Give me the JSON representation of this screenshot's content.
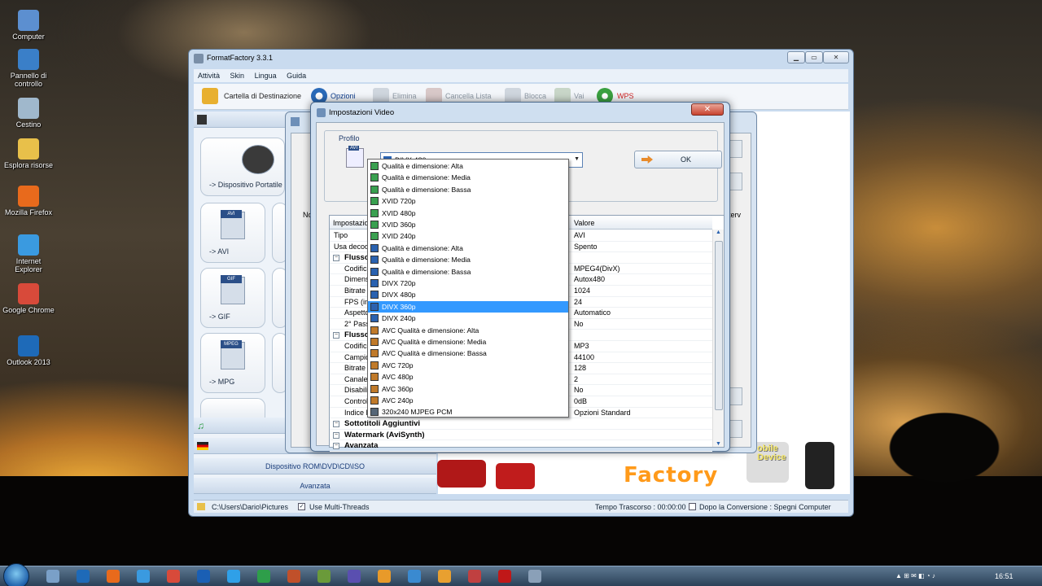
{
  "desktop": {
    "icons": [
      {
        "label": "Computer",
        "color": "#5c8fd0"
      },
      {
        "label": "Pannello di controllo",
        "color": "#3a7fc8"
      },
      {
        "label": "Cestino",
        "color": "#a0b8cc"
      },
      {
        "label": "Esplora risorse",
        "color": "#e8c04a"
      },
      {
        "label": "Mozilla Firefox",
        "color": "#e86a1c"
      },
      {
        "label": "Internet Explorer",
        "color": "#3a9ae0"
      },
      {
        "label": "Google Chrome",
        "color": "#d84a3a"
      },
      {
        "label": "Outlook 2013",
        "color": "#1e6ab8"
      }
    ]
  },
  "app": {
    "title": "FormatFactory 3.3.1",
    "window_controls": {
      "minimize": "▁",
      "maximize": "▭",
      "close": "✕"
    },
    "menu": [
      "Attività",
      "Skin",
      "Lingua",
      "Guida"
    ],
    "toolbar": {
      "destination": "Cartella di Destinazione",
      "options": "Opzioni",
      "delete": "Elimina",
      "clear": "Cancella Lista",
      "stop": "Blocca",
      "go": "Vai",
      "wps": "WPS"
    },
    "sidebar": {
      "portable": "-> Dispositivo Portatile",
      "formats": [
        {
          "tag": "AVI",
          "label": "-> AVI"
        },
        {
          "tag": "GIF",
          "label": "-> GIF"
        },
        {
          "tag": "MPEG",
          "label": "-> MPG"
        }
      ],
      "categories": {
        "rom": "Dispositivo ROM\\DVD\\CD\\ISO",
        "advanced": "Avanzata"
      }
    },
    "status": {
      "path": "C:\\Users\\Dario\\Pictures",
      "multithreads": "Use Multi-Threads",
      "elapsed": "Tempo Trascorso : 00:00:00",
      "after": "Dopo la Conversione : Spegni Computer"
    },
    "promo": {
      "brand": "Factory",
      "device": "obile Device"
    }
  },
  "background_dialog": {
    "col_left": "No",
    "col_right": "iterv"
  },
  "dialog": {
    "title": "Impostazioni Video",
    "close": "✕",
    "profile_group": "Profilo",
    "icon_tag": "AVI",
    "profile_value": "DIVX 480p",
    "ok": "OK",
    "grid": {
      "col_setting": "Impostazioni",
      "col_value": "Valore",
      "rows": [
        {
          "k": "Tipo",
          "v": "AVI",
          "kind": "plain"
        },
        {
          "k": "Usa decoder",
          "v": "Spento",
          "kind": "plain"
        },
        {
          "k": "Flusso Video",
          "v": "",
          "kind": "sec"
        },
        {
          "k": "Codifica",
          "v": "MPEG4(DivX)",
          "kind": "sub"
        },
        {
          "k": "Dimensioni",
          "v": "Autox480",
          "kind": "sub"
        },
        {
          "k": "Bitrate (K",
          "v": "1024",
          "kind": "sub"
        },
        {
          "k": "FPS (imm",
          "v": "24",
          "kind": "sub"
        },
        {
          "k": "Aspetto",
          "v": "Automatico",
          "kind": "sub"
        },
        {
          "k": "2° Passag",
          "v": "No",
          "kind": "sub"
        },
        {
          "k": "Flusso Audio",
          "v": "",
          "kind": "sec"
        },
        {
          "k": "Codifica A",
          "v": "MP3",
          "kind": "sub"
        },
        {
          "k": "Campiona",
          "v": "44100",
          "kind": "sub"
        },
        {
          "k": "Bitrate (K",
          "v": "128",
          "kind": "sub"
        },
        {
          "k": "Canale A",
          "v": "2",
          "kind": "sub"
        },
        {
          "k": "Disabilita",
          "v": "No",
          "kind": "sub"
        },
        {
          "k": "Controllo",
          "v": "0dB",
          "kind": "sub"
        },
        {
          "k": "Indice FL",
          "v": "Opzioni Standard",
          "kind": "sub"
        },
        {
          "k": "Sottotitoli Aggiuntivi",
          "v": "",
          "kind": "sec"
        },
        {
          "k": "Watermark (AviSynth)",
          "v": "",
          "kind": "sec"
        },
        {
          "k": "Avanzata",
          "v": "",
          "kind": "sec"
        }
      ]
    },
    "dropdown": [
      {
        "t": "Qualità e dimensione: Alta",
        "c": "#3aa050"
      },
      {
        "t": "Qualità e dimensione: Media",
        "c": "#3aa050"
      },
      {
        "t": "Qualità e dimensione: Bassa",
        "c": "#3aa050"
      },
      {
        "t": "XVID 720p",
        "c": "#3aa050"
      },
      {
        "t": "XVID 480p",
        "c": "#3aa050"
      },
      {
        "t": "XVID 360p",
        "c": "#3aa050"
      },
      {
        "t": "XVID 240p",
        "c": "#3aa050"
      },
      {
        "t": "Qualità e dimensione: Alta",
        "c": "#2a62b0"
      },
      {
        "t": "Qualità e dimensione: Media",
        "c": "#2a62b0"
      },
      {
        "t": "Qualità e dimensione: Bassa",
        "c": "#2a62b0"
      },
      {
        "t": "DIVX 720p",
        "c": "#2a62b0"
      },
      {
        "t": "DIVX 480p",
        "c": "#2a62b0"
      },
      {
        "t": "DIVX 360p",
        "c": "#2a62b0",
        "selected": true
      },
      {
        "t": "DIVX 240p",
        "c": "#2a62b0"
      },
      {
        "t": "AVC Qualità e dimensione: Alta",
        "c": "#c07a2a"
      },
      {
        "t": "AVC Qualità e dimensione: Media",
        "c": "#c07a2a"
      },
      {
        "t": "AVC Qualità e dimensione: Bassa",
        "c": "#c07a2a"
      },
      {
        "t": "AVC 720p",
        "c": "#c07a2a"
      },
      {
        "t": "AVC 480p",
        "c": "#c07a2a"
      },
      {
        "t": "AVC 360p",
        "c": "#c07a2a"
      },
      {
        "t": "AVC 240p",
        "c": "#c07a2a"
      },
      {
        "t": "320x240 MJPEG PCM",
        "c": "#556677"
      }
    ]
  },
  "taskbar": {
    "items": [
      "#7aa0c8",
      "#1e6ab8",
      "#e86a1c",
      "#3a9ae0",
      "#d84a3a",
      "#1a5fb4",
      "#2fa0e8",
      "#2e9e4a",
      "#c0502a",
      "#6a9a3a",
      "#5a4fb0",
      "#e89a2a",
      "#3a8ad0",
      "#e8a030",
      "#c04040",
      "#c01818",
      "#8aa0b8"
    ],
    "clock": "16:51"
  }
}
